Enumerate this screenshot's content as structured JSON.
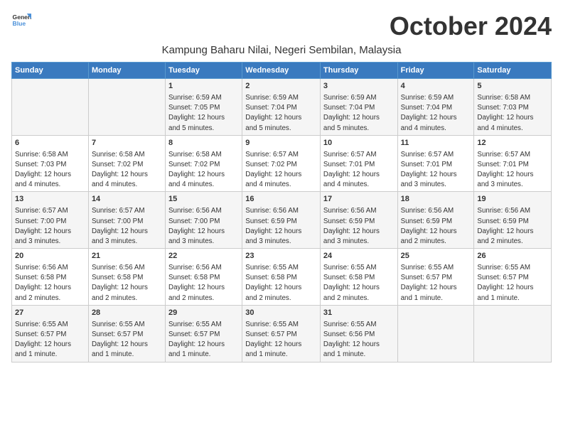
{
  "logo": {
    "line1": "General",
    "line2": "Blue"
  },
  "title": "October 2024",
  "location": "Kampung Baharu Nilai, Negeri Sembilan, Malaysia",
  "days_of_week": [
    "Sunday",
    "Monday",
    "Tuesday",
    "Wednesday",
    "Thursday",
    "Friday",
    "Saturday"
  ],
  "weeks": [
    [
      {
        "day": "",
        "info": ""
      },
      {
        "day": "",
        "info": ""
      },
      {
        "day": "1",
        "info": "Sunrise: 6:59 AM\nSunset: 7:05 PM\nDaylight: 12 hours\nand 5 minutes."
      },
      {
        "day": "2",
        "info": "Sunrise: 6:59 AM\nSunset: 7:04 PM\nDaylight: 12 hours\nand 5 minutes."
      },
      {
        "day": "3",
        "info": "Sunrise: 6:59 AM\nSunset: 7:04 PM\nDaylight: 12 hours\nand 5 minutes."
      },
      {
        "day": "4",
        "info": "Sunrise: 6:59 AM\nSunset: 7:04 PM\nDaylight: 12 hours\nand 4 minutes."
      },
      {
        "day": "5",
        "info": "Sunrise: 6:58 AM\nSunset: 7:03 PM\nDaylight: 12 hours\nand 4 minutes."
      }
    ],
    [
      {
        "day": "6",
        "info": "Sunrise: 6:58 AM\nSunset: 7:03 PM\nDaylight: 12 hours\nand 4 minutes."
      },
      {
        "day": "7",
        "info": "Sunrise: 6:58 AM\nSunset: 7:02 PM\nDaylight: 12 hours\nand 4 minutes."
      },
      {
        "day": "8",
        "info": "Sunrise: 6:58 AM\nSunset: 7:02 PM\nDaylight: 12 hours\nand 4 minutes."
      },
      {
        "day": "9",
        "info": "Sunrise: 6:57 AM\nSunset: 7:02 PM\nDaylight: 12 hours\nand 4 minutes."
      },
      {
        "day": "10",
        "info": "Sunrise: 6:57 AM\nSunset: 7:01 PM\nDaylight: 12 hours\nand 4 minutes."
      },
      {
        "day": "11",
        "info": "Sunrise: 6:57 AM\nSunset: 7:01 PM\nDaylight: 12 hours\nand 3 minutes."
      },
      {
        "day": "12",
        "info": "Sunrise: 6:57 AM\nSunset: 7:01 PM\nDaylight: 12 hours\nand 3 minutes."
      }
    ],
    [
      {
        "day": "13",
        "info": "Sunrise: 6:57 AM\nSunset: 7:00 PM\nDaylight: 12 hours\nand 3 minutes."
      },
      {
        "day": "14",
        "info": "Sunrise: 6:57 AM\nSunset: 7:00 PM\nDaylight: 12 hours\nand 3 minutes."
      },
      {
        "day": "15",
        "info": "Sunrise: 6:56 AM\nSunset: 7:00 PM\nDaylight: 12 hours\nand 3 minutes."
      },
      {
        "day": "16",
        "info": "Sunrise: 6:56 AM\nSunset: 6:59 PM\nDaylight: 12 hours\nand 3 minutes."
      },
      {
        "day": "17",
        "info": "Sunrise: 6:56 AM\nSunset: 6:59 PM\nDaylight: 12 hours\nand 3 minutes."
      },
      {
        "day": "18",
        "info": "Sunrise: 6:56 AM\nSunset: 6:59 PM\nDaylight: 12 hours\nand 2 minutes."
      },
      {
        "day": "19",
        "info": "Sunrise: 6:56 AM\nSunset: 6:59 PM\nDaylight: 12 hours\nand 2 minutes."
      }
    ],
    [
      {
        "day": "20",
        "info": "Sunrise: 6:56 AM\nSunset: 6:58 PM\nDaylight: 12 hours\nand 2 minutes."
      },
      {
        "day": "21",
        "info": "Sunrise: 6:56 AM\nSunset: 6:58 PM\nDaylight: 12 hours\nand 2 minutes."
      },
      {
        "day": "22",
        "info": "Sunrise: 6:56 AM\nSunset: 6:58 PM\nDaylight: 12 hours\nand 2 minutes."
      },
      {
        "day": "23",
        "info": "Sunrise: 6:55 AM\nSunset: 6:58 PM\nDaylight: 12 hours\nand 2 minutes."
      },
      {
        "day": "24",
        "info": "Sunrise: 6:55 AM\nSunset: 6:58 PM\nDaylight: 12 hours\nand 2 minutes."
      },
      {
        "day": "25",
        "info": "Sunrise: 6:55 AM\nSunset: 6:57 PM\nDaylight: 12 hours\nand 1 minute."
      },
      {
        "day": "26",
        "info": "Sunrise: 6:55 AM\nSunset: 6:57 PM\nDaylight: 12 hours\nand 1 minute."
      }
    ],
    [
      {
        "day": "27",
        "info": "Sunrise: 6:55 AM\nSunset: 6:57 PM\nDaylight: 12 hours\nand 1 minute."
      },
      {
        "day": "28",
        "info": "Sunrise: 6:55 AM\nSunset: 6:57 PM\nDaylight: 12 hours\nand 1 minute."
      },
      {
        "day": "29",
        "info": "Sunrise: 6:55 AM\nSunset: 6:57 PM\nDaylight: 12 hours\nand 1 minute."
      },
      {
        "day": "30",
        "info": "Sunrise: 6:55 AM\nSunset: 6:57 PM\nDaylight: 12 hours\nand 1 minute."
      },
      {
        "day": "31",
        "info": "Sunrise: 6:55 AM\nSunset: 6:56 PM\nDaylight: 12 hours\nand 1 minute."
      },
      {
        "day": "",
        "info": ""
      },
      {
        "day": "",
        "info": ""
      }
    ]
  ]
}
